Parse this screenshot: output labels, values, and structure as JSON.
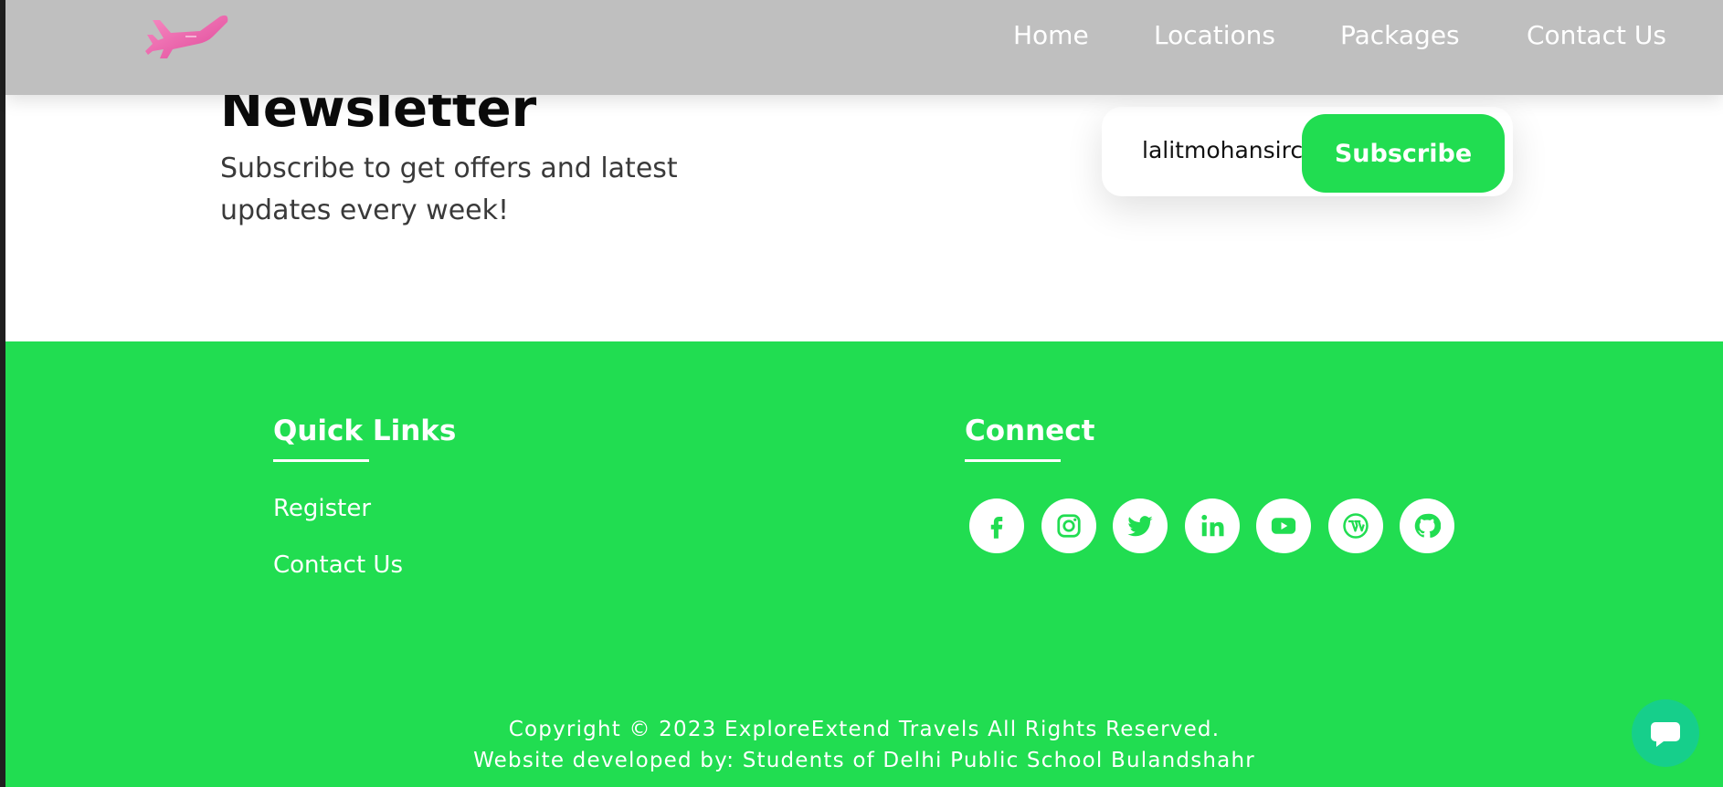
{
  "nav": {
    "logo_icon": "airplane-icon",
    "links": [
      "Home",
      "Locations",
      "Packages",
      "Contact Us"
    ]
  },
  "newsletter": {
    "title": "Newsletter",
    "text": "Subscribe to get offers and latest updates every week!",
    "input_value": "lalitmohansirc",
    "button_label": "Subscribe"
  },
  "footer": {
    "quick_links_title": "Quick Links",
    "quick_links": [
      "Register",
      "Contact Us"
    ],
    "connect_title": "Connect",
    "social_icons": [
      "facebook-icon",
      "instagram-icon",
      "twitter-icon",
      "linkedin-icon",
      "youtube-icon",
      "wordpress-icon",
      "github-icon"
    ],
    "copyright": "Copyright © 2023 ExploreExtend Travels All Rights Reserved.",
    "developer": "Website developed by: Students of Delhi Public School Bulandshahr"
  },
  "colors": {
    "header_bg": "#bfbfbf",
    "accent_green": "#21dd51",
    "chat_green": "#16cf8b",
    "logo_pink": "#f06aa9"
  },
  "chat_icon": "chat-bubble-icon"
}
